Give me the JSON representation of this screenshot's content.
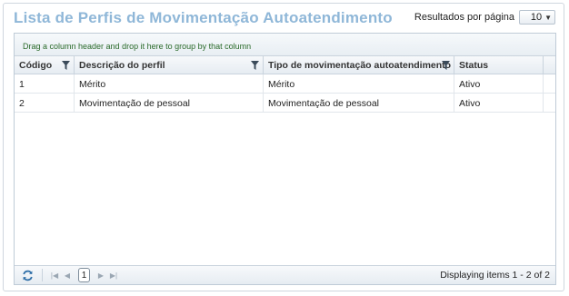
{
  "header": {
    "title": "Lista de Perfis de Movimentação Autoatendimento",
    "per_page_label": "Resultados por página",
    "per_page_value": "10"
  },
  "grid": {
    "group_hint": "Drag a column header and drop it here to group by that column",
    "columns": [
      {
        "label": "Código",
        "filter": true
      },
      {
        "label": "Descrição do perfil",
        "filter": true
      },
      {
        "label": "Tipo de movimentação autoatendimento",
        "filter": true
      },
      {
        "label": "Status",
        "filter": false
      }
    ],
    "rows": [
      [
        "1",
        "Mérito",
        "Mérito",
        "Ativo"
      ],
      [
        "2",
        "Movimentação de pessoal",
        "Movimentação de pessoal",
        "Ativo"
      ]
    ]
  },
  "pager": {
    "current_page": "1",
    "info": "Displaying items 1 - 2 of 2",
    "icons": [
      "refresh-icon",
      "first-page-icon",
      "prev-page-icon",
      "next-page-icon",
      "last-page-icon"
    ]
  },
  "colors": {
    "title": "#8fb7d8",
    "group_hint": "#2a6a2a",
    "border": "#bfcbd7"
  }
}
